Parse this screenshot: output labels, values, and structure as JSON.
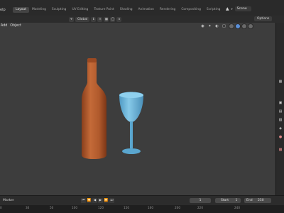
{
  "topbar": {
    "menu_help": "elp",
    "tabs": [
      "Layout",
      "Modeling",
      "Sculpting",
      "UV Editing",
      "Texture Paint",
      "Shading",
      "Animation",
      "Rendering",
      "Compositing",
      "Scripting"
    ],
    "active_tab_index": 0,
    "add_tab": "+",
    "scene": "Scene"
  },
  "header_tools": {
    "orientation": "Global",
    "options": "Options"
  },
  "viewport": {
    "header_left": [
      "Add",
      "Object"
    ],
    "background": "#3d3d3d",
    "bottle_color": "#b05a2c",
    "glass_color": "#6ab4d8"
  },
  "timeline": {
    "marker": "Marker",
    "current_frame": "1",
    "start_label": "Start",
    "start_value": "1",
    "end_label": "End",
    "end_value": "250"
  },
  "ruler": {
    "ticks": [
      "0",
      "30",
      "50",
      "100",
      "120",
      "150",
      "160",
      "200",
      "220",
      "240"
    ]
  },
  "accent": "#5a8fd8"
}
